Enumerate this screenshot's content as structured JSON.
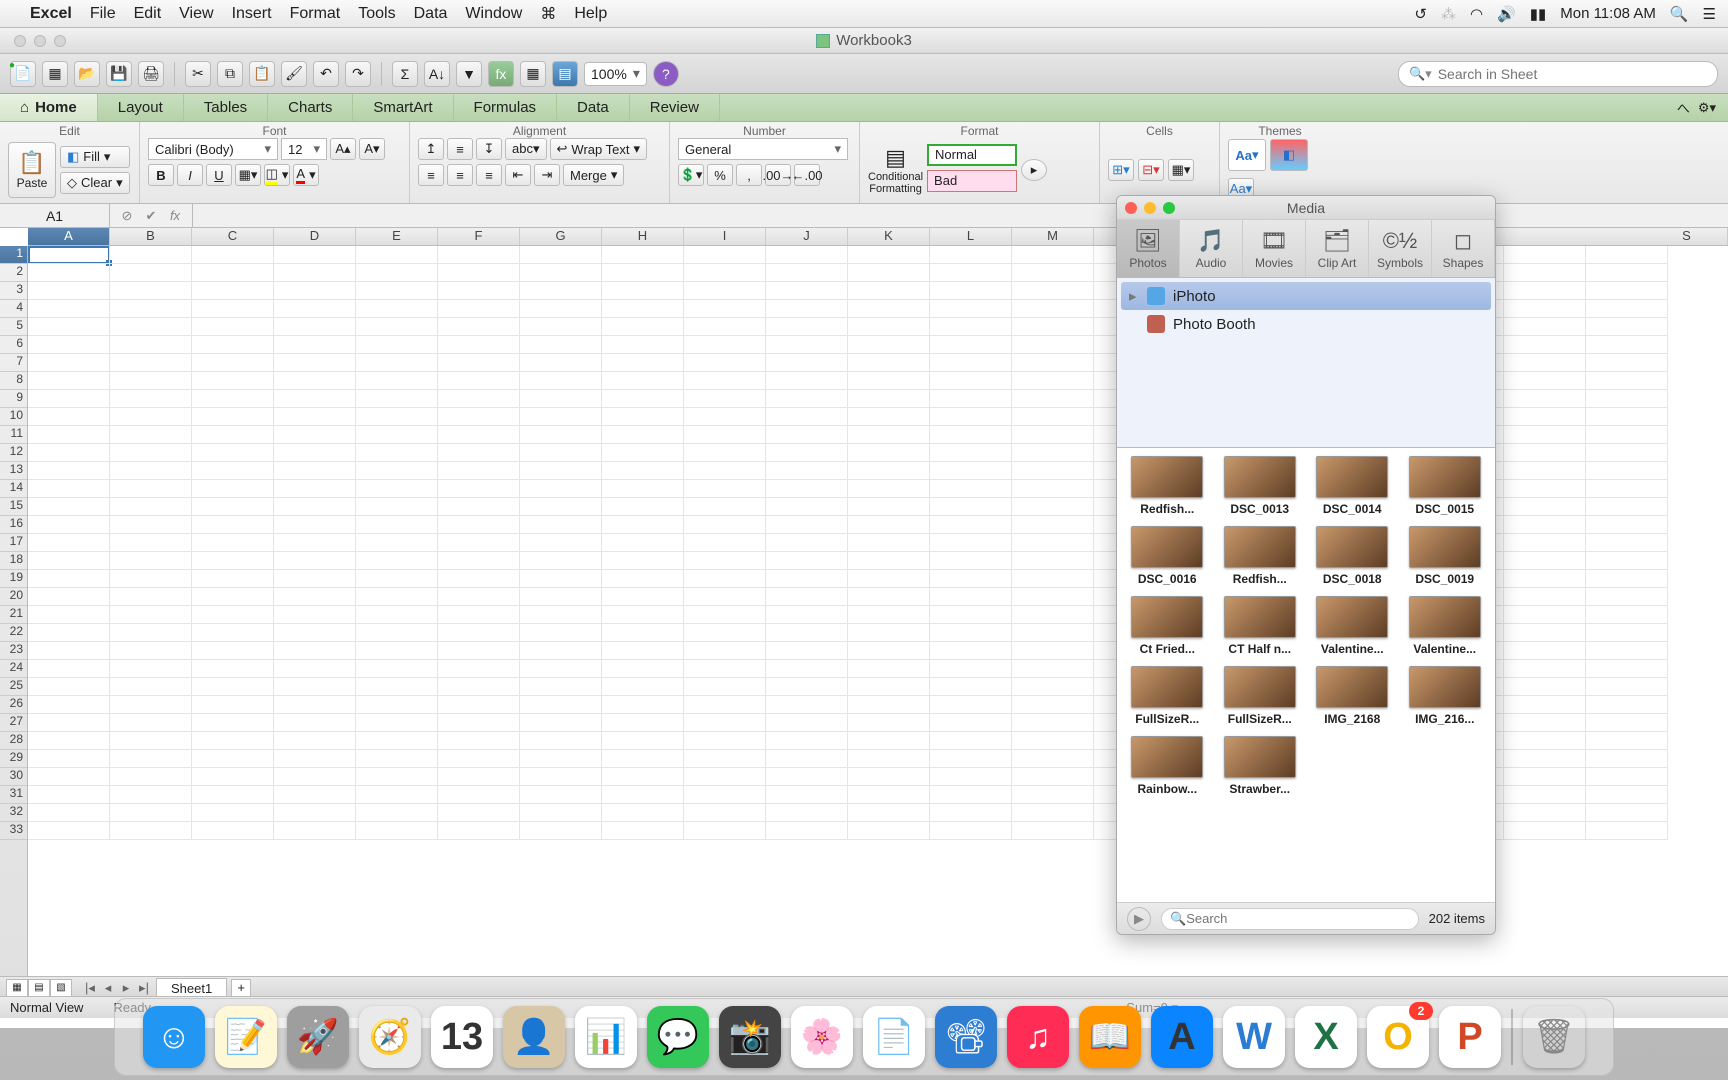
{
  "menubar": {
    "app": "Excel",
    "items": [
      "File",
      "Edit",
      "View",
      "Insert",
      "Format",
      "Tools",
      "Data",
      "Window"
    ],
    "help": "Help",
    "clock": "Mon 11:08 AM"
  },
  "window": {
    "title": "Workbook3"
  },
  "toolbar": {
    "zoom": "100%",
    "search_placeholder": "Search in Sheet"
  },
  "tabs": [
    "A Home",
    "Layout",
    "Tables",
    "Charts",
    "SmartArt",
    "Formulas",
    "Data",
    "Review"
  ],
  "ribbon": {
    "groups": [
      "Edit",
      "Font",
      "Alignment",
      "Number",
      "Format",
      "Cells",
      "Themes"
    ],
    "paste": "Paste",
    "fill": "Fill",
    "clear": "Clear",
    "font_name": "Calibri (Body)",
    "font_size": "12",
    "wrap": "Wrap Text",
    "merge": "Merge",
    "number_format": "General",
    "cond_fmt": "Conditional\nFormatting",
    "style_normal": "Normal",
    "style_bad": "Bad",
    "themes_aa": "Aa"
  },
  "refbar": {
    "cellref": "A1",
    "fx": "fx"
  },
  "sheet": {
    "columns": [
      "A",
      "B",
      "C",
      "D",
      "E",
      "F",
      "G",
      "H",
      "I",
      "J",
      "K",
      "L",
      "M",
      "S"
    ],
    "rows": 33,
    "active": "A1",
    "tab": "Sheet1"
  },
  "status": {
    "view": "Normal View",
    "state": "Ready",
    "sum": "Sum=0"
  },
  "media": {
    "title": "Media",
    "tabs": [
      {
        "label": "Photos",
        "icon": "🖼"
      },
      {
        "label": "Audio",
        "icon": "🎵"
      },
      {
        "label": "Movies",
        "icon": "🎞"
      },
      {
        "label": "Clip Art",
        "icon": "🗂"
      },
      {
        "label": "Symbols",
        "icon": "©½"
      },
      {
        "label": "Shapes",
        "icon": "◻"
      }
    ],
    "sources": [
      {
        "name": "iPhoto",
        "selected": true,
        "icon_bg": "#55a6e6"
      },
      {
        "name": "Photo Booth",
        "selected": false,
        "icon_bg": "#c06050"
      }
    ],
    "thumbs": [
      "Redfish...",
      "DSC_0013",
      "DSC_0014",
      "DSC_0015",
      "DSC_0016",
      "Redfish...",
      "DSC_0018",
      "DSC_0019",
      "Ct Fried...",
      "CT Half n...",
      "Valentine...",
      "Valentine...",
      "FullSizeR...",
      "FullSizeR...",
      "IMG_2168",
      "IMG_216...",
      "Rainbow...",
      "Strawber..."
    ],
    "search_placeholder": "Search",
    "count": "202 items"
  },
  "dock": {
    "apps": [
      {
        "name": "finder",
        "bg": "#2196f3",
        "glyph": "☺"
      },
      {
        "name": "notes",
        "bg": "#fff8d6",
        "glyph": "📝"
      },
      {
        "name": "launchpad",
        "bg": "#9e9e9e",
        "glyph": "🚀"
      },
      {
        "name": "safari",
        "bg": "#eaeaea",
        "glyph": "🧭"
      },
      {
        "name": "calendar",
        "bg": "#ffffff",
        "glyph": "13"
      },
      {
        "name": "contacts",
        "bg": "#d8c7a7",
        "glyph": "👤"
      },
      {
        "name": "numbers",
        "bg": "#ffffff",
        "glyph": "📊"
      },
      {
        "name": "messages",
        "bg": "#34c759",
        "glyph": "💬"
      },
      {
        "name": "photobooth",
        "bg": "#444",
        "glyph": "📸"
      },
      {
        "name": "photos",
        "bg": "#ffffff",
        "glyph": "🌸"
      },
      {
        "name": "pages",
        "bg": "#ffffff",
        "glyph": "📄"
      },
      {
        "name": "keynote",
        "bg": "#2d7dd2",
        "glyph": "📽"
      },
      {
        "name": "itunes",
        "bg": "#ff2d55",
        "glyph": "♫"
      },
      {
        "name": "ibooks",
        "bg": "#ff9500",
        "glyph": "📖"
      },
      {
        "name": "appstore",
        "bg": "#0a84ff",
        "glyph": "A"
      },
      {
        "name": "word",
        "bg": "#ffffff",
        "glyph": "W",
        "color": "#2b7cd3"
      },
      {
        "name": "excel",
        "bg": "#ffffff",
        "glyph": "X",
        "color": "#1f7244"
      },
      {
        "name": "outlook",
        "bg": "#ffffff",
        "glyph": "O",
        "color": "#f5b301",
        "badge": "2"
      },
      {
        "name": "powerpoint",
        "bg": "#ffffff",
        "glyph": "P",
        "color": "#d24726"
      }
    ],
    "trash": {
      "name": "trash",
      "glyph": "🗑"
    }
  }
}
